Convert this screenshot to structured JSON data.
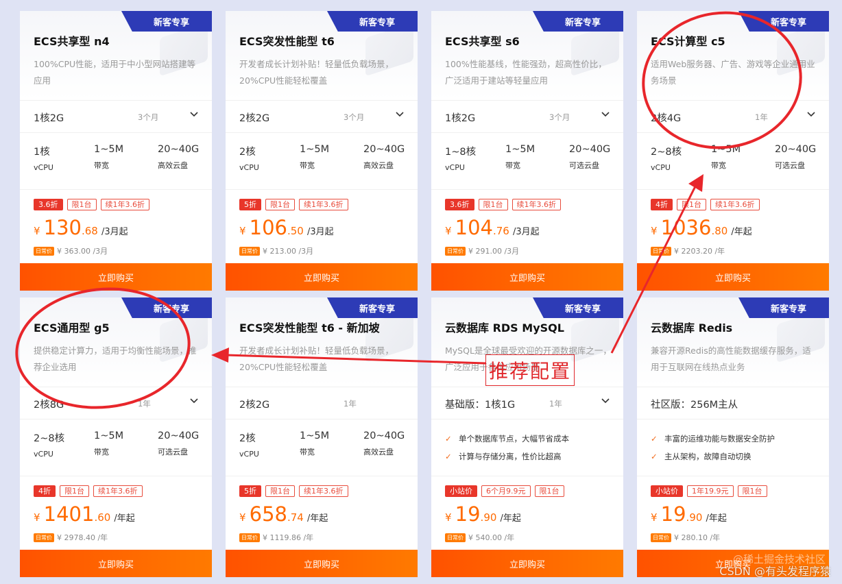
{
  "badge_text": "新客专享",
  "buy_label": "立即购买",
  "orig_tag": "日常价",
  "currency": "¥",
  "accent_color": "#ff6a00",
  "annotation_text": "推荐配置",
  "watermark": "CSDN @有头发程序猿",
  "watermark2": "@稀土掘金技术社区",
  "cards": [
    {
      "title": "ECS共享型 n4",
      "desc": "100%CPU性能，适用于中小型网站搭建等应用",
      "config": "1核2G",
      "duration": "3个月",
      "has_dropdown": true,
      "stats": [
        {
          "v": "1核",
          "l": "vCPU"
        },
        {
          "v": "1~5M",
          "l": "带宽"
        },
        {
          "v": "20~40G",
          "l": "高效云盘"
        }
      ],
      "tags": [
        "3.6折",
        "限1台",
        "续1年3.6折"
      ],
      "price_int": "130",
      "price_dec": ".68",
      "price_unit": "/3月起",
      "orig_price": "¥ 363.00 /3月"
    },
    {
      "title": "ECS突发性能型 t6",
      "desc": "开发者成长计划补贴！轻量低负载场景，20%CPU性能轻松覆盖",
      "config": "2核2G",
      "duration": "3个月",
      "has_dropdown": true,
      "stats": [
        {
          "v": "2核",
          "l": "vCPU"
        },
        {
          "v": "1~5M",
          "l": "带宽"
        },
        {
          "v": "20~40G",
          "l": "高效云盘"
        }
      ],
      "tags": [
        "5折",
        "限1台",
        "续1年3.6折"
      ],
      "price_int": "106",
      "price_dec": ".50",
      "price_unit": "/3月起",
      "orig_price": "¥ 213.00 /3月"
    },
    {
      "title": "ECS共享型 s6",
      "desc": "100%性能基线，性能强劲，超高性价比，广泛适用于建站等轻量应用",
      "config": "1核2G",
      "duration": "3个月",
      "has_dropdown": true,
      "stats": [
        {
          "v": "1~8核",
          "l": "vCPU"
        },
        {
          "v": "1~5M",
          "l": "带宽"
        },
        {
          "v": "20~40G",
          "l": "可选云盘"
        }
      ],
      "tags": [
        "3.6折",
        "限1台",
        "续1年3.6折"
      ],
      "price_int": "104",
      "price_dec": ".76",
      "price_unit": "/3月起",
      "orig_price": "¥ 291.00 /3月"
    },
    {
      "title": "ECS计算型 c5",
      "desc": "适用Web服务器、广告、游戏等企业通用业务场景",
      "config": "2核4G",
      "duration": "1年",
      "has_dropdown": true,
      "stats": [
        {
          "v": "2~8核",
          "l": "vCPU"
        },
        {
          "v": "1~5M",
          "l": "带宽"
        },
        {
          "v": "20~40G",
          "l": "可选云盘"
        }
      ],
      "tags": [
        "4折",
        "限1台",
        "续1年3.6折"
      ],
      "price_int": "1036",
      "price_dec": ".80",
      "price_unit": "/年起",
      "orig_price": "¥ 2203.20 /年"
    },
    {
      "title": "ECS通用型 g5",
      "desc": "提供稳定计算力，适用于均衡性能场景，推荐企业选用",
      "config": "2核8G",
      "duration": "1年",
      "has_dropdown": true,
      "stats": [
        {
          "v": "2~8核",
          "l": "vCPU"
        },
        {
          "v": "1~5M",
          "l": "带宽"
        },
        {
          "v": "20~40G",
          "l": "可选云盘"
        }
      ],
      "tags": [
        "4折",
        "限1台",
        "续1年3.6折"
      ],
      "price_int": "1401",
      "price_dec": ".60",
      "price_unit": "/年起",
      "orig_price": "¥ 2978.40 /年"
    },
    {
      "title": "ECS突发性能型 t6 - 新加坡",
      "desc": "开发者成长计划补贴！轻量低负载场景，20%CPU性能轻松覆盖",
      "config": "2核2G",
      "duration": "1年",
      "has_dropdown": false,
      "stats": [
        {
          "v": "2核",
          "l": "vCPU"
        },
        {
          "v": "1~5M",
          "l": "带宽"
        },
        {
          "v": "20~40G",
          "l": "高效云盘"
        }
      ],
      "tags": [
        "5折",
        "限1台",
        "续1年3.6折"
      ],
      "price_int": "658",
      "price_dec": ".74",
      "price_unit": "/年起",
      "orig_price": "¥ 1119.86 /年"
    },
    {
      "title": "云数据库 RDS MySQL",
      "desc": "MySQL是全球最受欢迎的开源数据库之一，广泛应用于各类应用场景",
      "config": "基础版：1核1G",
      "duration": "1年",
      "has_dropdown": true,
      "features": [
        "单个数据库节点，大幅节省成本",
        "计算与存储分离，性价比超高"
      ],
      "tags": [
        "小站价",
        "6个月9.9元",
        "限1台"
      ],
      "price_int": "19",
      "price_dec": ".90",
      "price_unit": "/年起",
      "orig_price": "¥ 540.00 /年"
    },
    {
      "title": "云数据库 Redis",
      "desc": "兼容开源Redis的高性能数据缓存服务，适用于互联网在线热点业务",
      "config": "社区版：256M主从",
      "duration": "",
      "has_dropdown": false,
      "features": [
        "丰富的运维功能与数据安全防护",
        "主从架构，故障自动切换"
      ],
      "tags": [
        "小站价",
        "1年19.9元",
        "限1台"
      ],
      "price_int": "19",
      "price_dec": ".90",
      "price_unit": "/年起",
      "orig_price": "¥ 280.10 /年"
    }
  ]
}
